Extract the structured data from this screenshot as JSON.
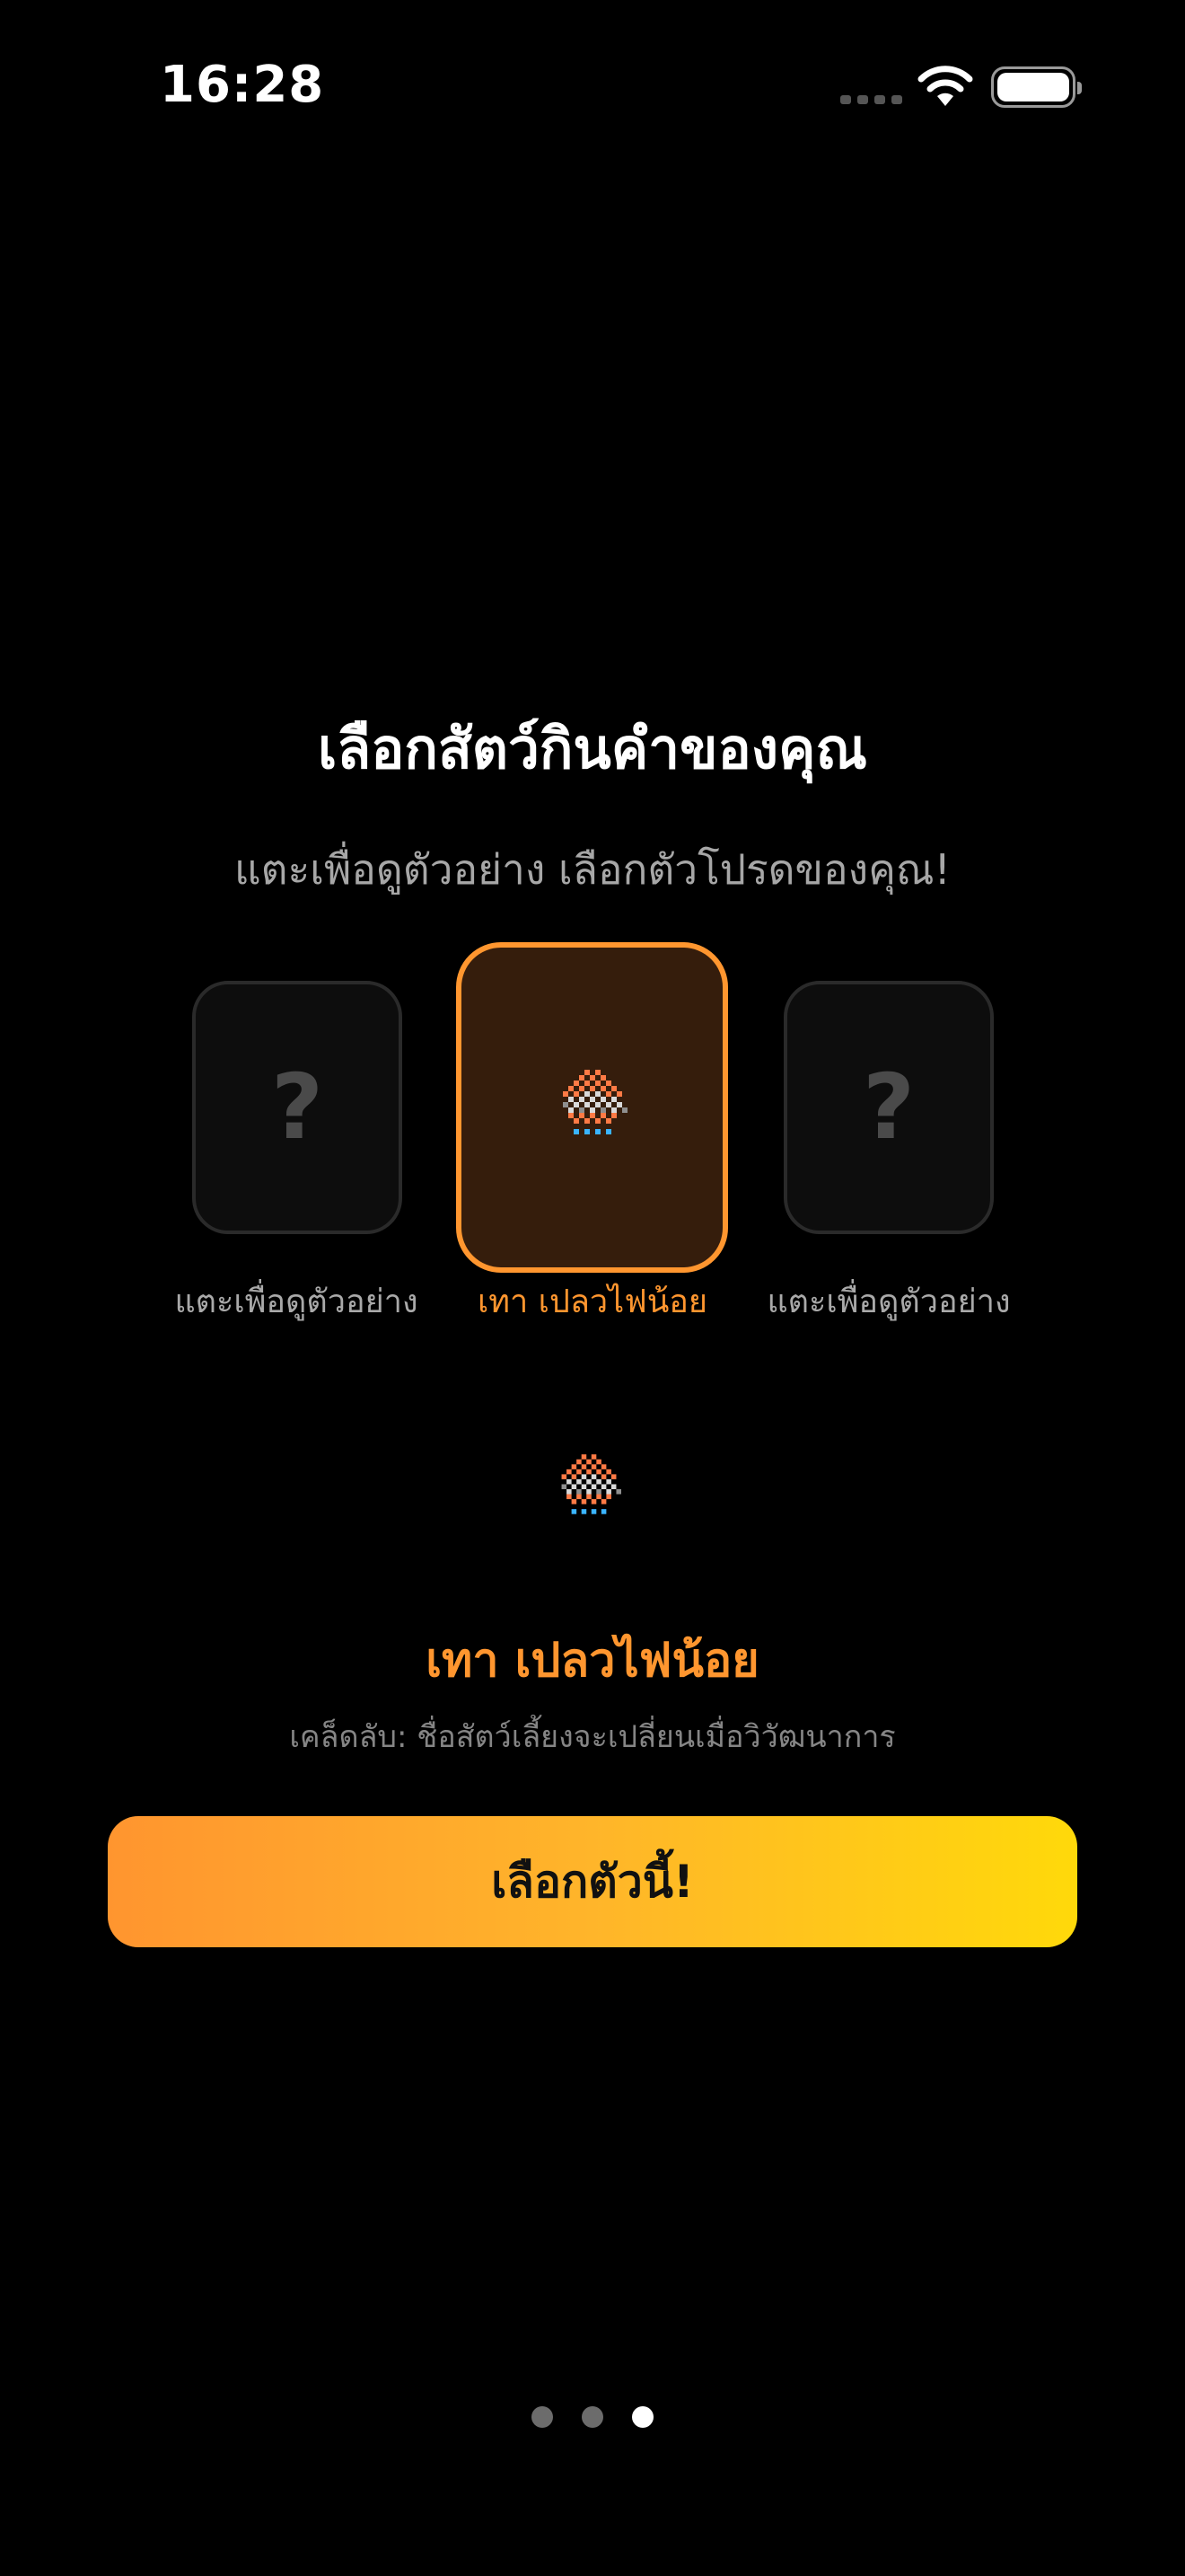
{
  "status_bar": {
    "time": "16:28",
    "icons": [
      "cellular-signal-icon",
      "wifi-icon",
      "battery-icon"
    ]
  },
  "onboarding": {
    "title": "เลือกสัตว์กินคำของคุณ",
    "subtitle": "แตะเพื่อดูตัวอย่าง เลือกตัวโปรดของคุณ!",
    "cards": [
      {
        "symbol": "?",
        "label": "แตะเพื่อดูตัวอย่าง",
        "state": "locked"
      },
      {
        "symbol": "",
        "label": "เทา เปลวไฟน้อย",
        "state": "selected"
      },
      {
        "symbol": "?",
        "label": "แตะเพื่อดูตัวอย่าง",
        "state": "locked"
      }
    ],
    "preview": {
      "name": "เทา เปลวไฟน้อย",
      "tip": "เคล็ดลับ: ชื่อสัตว์เลี้ยงจะเปลี่ยนเมื่อวิวัฒนาการ"
    },
    "choose_button_label": "เลือกตัวนี้!",
    "pagination": {
      "total": 3,
      "current": 3
    }
  },
  "colors": {
    "background": "#000000",
    "accent": "#ff962f",
    "button_gradient_start": "#ff952f",
    "button_gradient_end": "#ffd90a",
    "selected_card_bg": "#351d0c",
    "locked_card_bg": "#0d0d0d",
    "muted_text": "#a7a7a7"
  }
}
